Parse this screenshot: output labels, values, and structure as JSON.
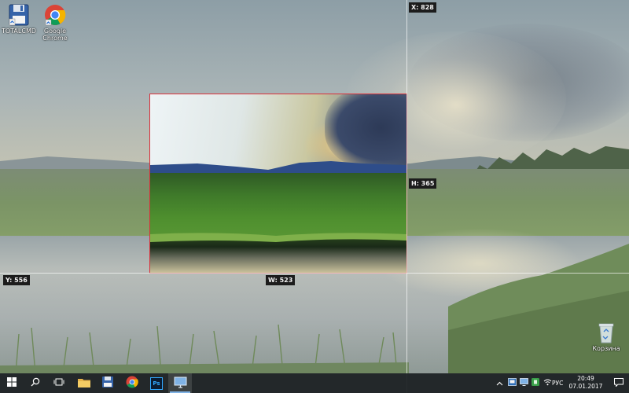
{
  "desktop": {
    "icons": [
      {
        "label": "TOTALCMD",
        "icon": "floppy-disk-icon"
      },
      {
        "label": "Google Chrome",
        "icon": "chrome-icon"
      },
      {
        "label": "Корзина",
        "icon": "recycle-bin-icon"
      }
    ]
  },
  "measurements": {
    "x_label": "X: 828",
    "y_label": "Y: 556",
    "w_label": "W: 523",
    "h_label": "H: 365"
  },
  "selection": {
    "border_color": "#d9303a"
  },
  "taskbar": {
    "buttons": [
      {
        "name": "start",
        "icon": "windows-logo-icon"
      },
      {
        "name": "search",
        "icon": "search-icon"
      },
      {
        "name": "task-view",
        "icon": "task-view-icon"
      },
      {
        "name": "file-explorer",
        "icon": "folder-icon"
      },
      {
        "name": "totalcmd",
        "icon": "floppy-disk-icon"
      },
      {
        "name": "chrome",
        "icon": "chrome-icon"
      },
      {
        "name": "photoshop",
        "icon": "photoshop-icon",
        "text": "Ps"
      },
      {
        "name": "screen-capture",
        "icon": "monitor-icon",
        "active": true
      }
    ],
    "tray": {
      "language": "РУС",
      "time": "20:49",
      "date": "07.01.2017",
      "icons": [
        "chevron-up-icon",
        "app-tray-icon",
        "monitor-icon",
        "green-app-icon",
        "wifi-icon",
        "volume-icon",
        "notification-icon"
      ]
    },
    "accent_color": "#7fb2e5"
  }
}
